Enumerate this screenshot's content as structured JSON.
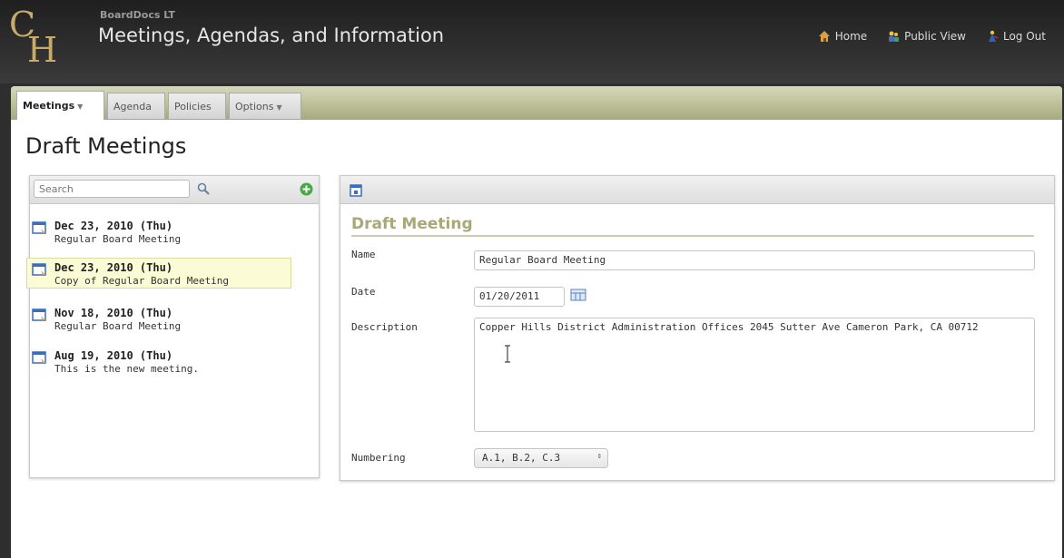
{
  "header": {
    "logo_text": "CH",
    "app_name": "BoardDocs LT",
    "title": "Meetings, Agendas, and Information",
    "links": [
      {
        "label": "Home",
        "icon": "home-icon"
      },
      {
        "label": "Public View",
        "icon": "public-view-icon"
      },
      {
        "label": "Log Out",
        "icon": "log-out-icon"
      }
    ]
  },
  "tabs": [
    {
      "label": "Meetings",
      "caret": "▼",
      "active": true
    },
    {
      "label": "Agenda"
    },
    {
      "label": "Policies"
    },
    {
      "label": "Options",
      "caret": "▼"
    }
  ],
  "page_title": "Draft Meetings",
  "list": {
    "search_placeholder": "Search",
    "items": [
      {
        "date": "Dec 23, 2010 (Thu)",
        "subtitle": "Regular Board Meeting",
        "selected": false
      },
      {
        "date": "Dec 23, 2010 (Thu)",
        "subtitle": "Copy of Regular Board Meeting",
        "selected": true
      },
      {
        "date": "Nov 18, 2010 (Thu)",
        "subtitle": "Regular Board Meeting",
        "selected": false
      },
      {
        "date": "Aug 19, 2010 (Thu)",
        "subtitle": "This is the new meeting.",
        "selected": false
      }
    ]
  },
  "detail": {
    "section_title": "Draft Meeting",
    "name_label": "Name",
    "name_value": "Regular Board Meeting",
    "date_label": "Date",
    "date_value": "01/20/2011",
    "description_label": "Description",
    "description_value": "Copper Hills District Administration Offices 2045 Sutter Ave Cameron Park, CA 00712",
    "numbering_label": "Numbering",
    "numbering_value": "A.1, B.2, C.3"
  },
  "colors": {
    "header_bg": "#2e2e2e",
    "tabbar": "#a6aa7e",
    "section_title": "#a8a878",
    "selected_row": "#fbfbd6"
  }
}
